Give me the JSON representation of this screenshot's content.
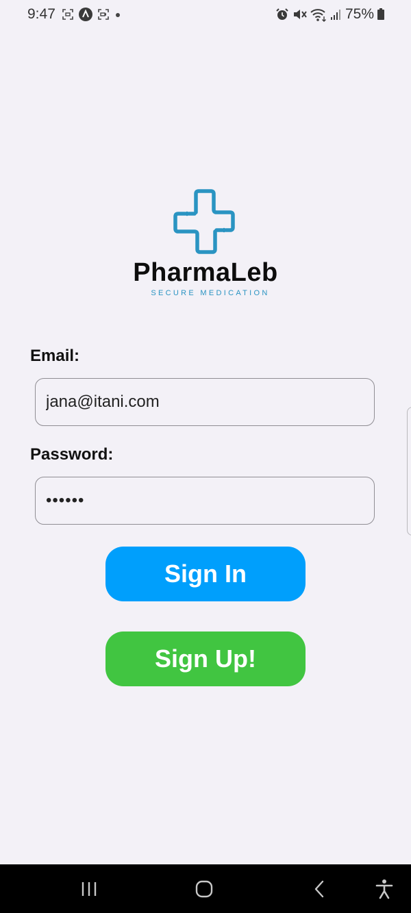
{
  "status_bar": {
    "time": "9:47",
    "left_icons": [
      "screenshot-icon",
      "app-icon",
      "screen-record-icon",
      "dot-icon"
    ],
    "right_icons": [
      "alarm-icon",
      "mute-icon",
      "wifi-icon",
      "signal-icon",
      "battery-icon"
    ],
    "battery": "75%"
  },
  "logo": {
    "icon": "medical-cross-icon",
    "name": "PharmaLeb",
    "tagline": "SECURE MEDICATION",
    "color": "#2a94c2"
  },
  "form": {
    "email_label": "Email:",
    "email_value": "jana@itani.com",
    "password_label": "Password:",
    "password_value": "••••••"
  },
  "buttons": {
    "sign_in": "Sign In",
    "sign_up": "Sign Up!",
    "sign_in_color": "#009ffc",
    "sign_up_color": "#41c541"
  },
  "nav_bar": {
    "icons": [
      "recents-icon",
      "home-icon",
      "back-icon",
      "accessibility-icon"
    ]
  }
}
